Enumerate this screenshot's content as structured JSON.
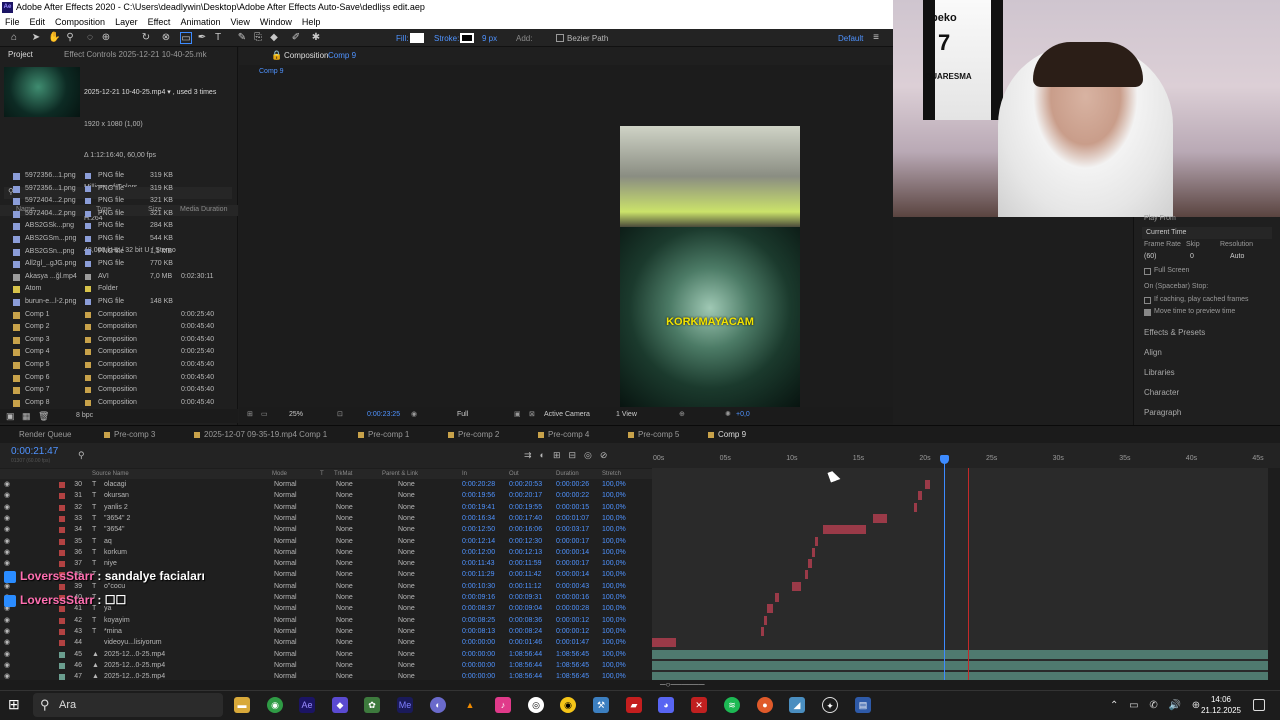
{
  "window": {
    "title": "Adobe After Effects 2020 - C:\\Users\\deadlywin\\Desktop\\Adobe After Effects Auto-Save\\dedlişs edit.aep"
  },
  "menu": [
    "File",
    "Edit",
    "Composition",
    "Layer",
    "Effect",
    "Animation",
    "View",
    "Window",
    "Help"
  ],
  "toolbar": {
    "fill_label": "Fill:",
    "stroke_label": "Stroke:",
    "stroke_px": "9 px",
    "add_label": "Add:",
    "bezier_label": "Bezier Path",
    "workspace": "Default"
  },
  "project": {
    "tab_project": "Project",
    "tab_effect": "Effect Controls 2025-12-21 10-40-25.mk",
    "file_name": "2025-12-21 10-40-25.mp4 ▾ , used 3 times",
    "info_lines": [
      "1920 x 1080 (1,00)",
      "Δ 1:12:16:40, 60,00 fps",
      "Millions of Colors",
      "H.264",
      "48,000 kHz / 32 bit U / Stereo"
    ],
    "search_placeholder": "⚲",
    "headers": {
      "name": "Name",
      "type": "Type",
      "size": "Size",
      "duration": "Media Duration"
    },
    "items": [
      {
        "name": "5972356...1.png",
        "type": "PNG file",
        "size": "319 KB",
        "dur": "",
        "color": "#8b9dd8"
      },
      {
        "name": "5972356...1.png",
        "type": "PNG file",
        "size": "319 KB",
        "dur": "",
        "color": "#8b9dd8"
      },
      {
        "name": "5972404...2.png",
        "type": "PNG file",
        "size": "321 KB",
        "dur": "",
        "color": "#8b9dd8"
      },
      {
        "name": "5972404...2.png",
        "type": "PNG file",
        "size": "321 KB",
        "dur": "",
        "color": "#8b9dd8"
      },
      {
        "name": "ABS2GSk...png",
        "type": "PNG file",
        "size": "284 KB",
        "dur": "",
        "color": "#8b9dd8"
      },
      {
        "name": "ABS2GSm...png",
        "type": "PNG file",
        "size": "544 KB",
        "dur": "",
        "color": "#8b9dd8"
      },
      {
        "name": "ABS2GSn...png",
        "type": "PNG file",
        "size": "1,1 MB",
        "dur": "",
        "color": "#8b9dd8"
      },
      {
        "name": "All2gl_..gJG.png",
        "type": "PNG file",
        "size": "770 KB",
        "dur": "",
        "color": "#8b9dd8"
      },
      {
        "name": "Akasya ...ğl.mp4",
        "type": "AVI",
        "size": "7,0 MB",
        "dur": "0:02:30:11",
        "color": "#9c9c9c"
      },
      {
        "name": "Atom",
        "type": "Folder",
        "size": "",
        "dur": "",
        "color": "#d6c24a"
      },
      {
        "name": "burun-e...l-2.png",
        "type": "PNG file",
        "size": "148 KB",
        "dur": "",
        "color": "#8b9dd8"
      },
      {
        "name": "Comp 1",
        "type": "Composition",
        "size": "",
        "dur": "0:00:25:40",
        "color": "#c8a24a"
      },
      {
        "name": "Comp 2",
        "type": "Composition",
        "size": "",
        "dur": "0:00:45:40",
        "color": "#c8a24a"
      },
      {
        "name": "Comp 3",
        "type": "Composition",
        "size": "",
        "dur": "0:00:45:40",
        "color": "#c8a24a"
      },
      {
        "name": "Comp 4",
        "type": "Composition",
        "size": "",
        "dur": "0:00:25:40",
        "color": "#c8a24a"
      },
      {
        "name": "Comp 5",
        "type": "Composition",
        "size": "",
        "dur": "0:00:45:40",
        "color": "#c8a24a"
      },
      {
        "name": "Comp 6",
        "type": "Composition",
        "size": "",
        "dur": "0:00:45:40",
        "color": "#c8a24a"
      },
      {
        "name": "Comp 7",
        "type": "Composition",
        "size": "",
        "dur": "0:00:45:40",
        "color": "#c8a24a"
      },
      {
        "name": "Comp 8",
        "type": "Composition",
        "size": "",
        "dur": "0:00:45:40",
        "color": "#c8a24a"
      }
    ],
    "footer_bpc": "8 bpc"
  },
  "composition": {
    "tab_label": "Composition",
    "tab_comp": "Comp 9",
    "subtab": "Comp 9",
    "overlay_text": "KORKMAYACAM",
    "zoom": "25%",
    "timecode": "0:00:23:25",
    "resolution": "Full",
    "camera": "Active Camera",
    "view": "1 View",
    "exposure": "+0,0"
  },
  "webcam": {
    "jersey_brand": "beko",
    "jersey_number": "7",
    "jersey_name": "QUARESMA"
  },
  "preview": {
    "title": "Play From",
    "current_time": "Current Time",
    "frame_rate_label": "Frame Rate",
    "skip_label": "Skip",
    "resolution_label": "Resolution",
    "frame_rate": "(60)",
    "skip": "0",
    "resolution": "Auto",
    "full_screen": "Full Screen",
    "on_stop": "On (Spacebar) Stop:",
    "cache_opt": "If caching, play cached frames",
    "move_opt": "Move time to preview time",
    "panels": [
      "Effects & Presets",
      "Align",
      "Libraries",
      "Character",
      "Paragraph"
    ]
  },
  "timeline": {
    "tabs": [
      {
        "label": "Render Queue",
        "color": ""
      },
      {
        "label": "Pre-comp 3",
        "color": "#c8a24a"
      },
      {
        "label": "2025-12-07 09-35-19.mp4 Comp 1",
        "color": "#c8a24a"
      },
      {
        "label": "Pre-comp 1",
        "color": "#c8a24a"
      },
      {
        "label": "Pre-comp 2",
        "color": "#c8a24a"
      },
      {
        "label": "Pre-comp 4",
        "color": "#c8a24a"
      },
      {
        "label": "Pre-comp 5",
        "color": "#c8a24a"
      },
      {
        "label": "Comp 9",
        "color": "#c8a24a"
      }
    ],
    "timecode": "0:00:21:47",
    "timecode_sub": "01307 (60.00 fps)",
    "headers": {
      "source": "Source Name",
      "mode": "Mode",
      "t": "T",
      "trkmat": "TrkMat",
      "parent": "Parent & Link",
      "in": "In",
      "out": "Out",
      "duration": "Duration",
      "stretch": "Stretch"
    },
    "ruler": [
      "00s",
      "05s",
      "10s",
      "15s",
      "20s",
      "25s",
      "30s",
      "35s",
      "40s",
      "45s"
    ],
    "layers": [
      {
        "num": "30",
        "type": "T",
        "name": "olacagi",
        "mode": "Normal",
        "trk": "None",
        "parent": "None",
        "in": "0:00:20:28",
        "out": "0:00:20:53",
        "dur": "0:00:00:26",
        "str": "100,0%",
        "color": "#b24242"
      },
      {
        "num": "31",
        "type": "T",
        "name": "okursan",
        "mode": "Normal",
        "trk": "None",
        "parent": "None",
        "in": "0:00:19:56",
        "out": "0:00:20:17",
        "dur": "0:00:00:22",
        "str": "100,0%",
        "color": "#b24242"
      },
      {
        "num": "32",
        "type": "T",
        "name": "yanlis 2",
        "mode": "Normal",
        "trk": "None",
        "parent": "None",
        "in": "0:00:19:41",
        "out": "0:00:19:55",
        "dur": "0:00:00:15",
        "str": "100,0%",
        "color": "#b24242"
      },
      {
        "num": "33",
        "type": "T",
        "name": "\"3654\" 2",
        "mode": "Normal",
        "trk": "None",
        "parent": "None",
        "in": "0:00:16:34",
        "out": "0:00:17:40",
        "dur": "0:00:01:07",
        "str": "100,0%",
        "color": "#b24242"
      },
      {
        "num": "34",
        "type": "T",
        "name": "\"3654\"",
        "mode": "Normal",
        "trk": "None",
        "parent": "None",
        "in": "0:00:12:50",
        "out": "0:00:16:06",
        "dur": "0:00:03:17",
        "str": "100,0%",
        "color": "#b24242"
      },
      {
        "num": "35",
        "type": "T",
        "name": "aq",
        "mode": "Normal",
        "trk": "None",
        "parent": "None",
        "in": "0:00:12:14",
        "out": "0:00:12:30",
        "dur": "0:00:00:17",
        "str": "100,0%",
        "color": "#b24242"
      },
      {
        "num": "36",
        "type": "T",
        "name": "korkum",
        "mode": "Normal",
        "trk": "None",
        "parent": "None",
        "in": "0:00:12:00",
        "out": "0:00:12:13",
        "dur": "0:00:00:14",
        "str": "100,0%",
        "color": "#b24242"
      },
      {
        "num": "37",
        "type": "T",
        "name": "niye",
        "mode": "Normal",
        "trk": "None",
        "parent": "None",
        "in": "0:00:11:43",
        "out": "0:00:11:59",
        "dur": "0:00:00:17",
        "str": "100,0%",
        "color": "#b24242"
      },
      {
        "num": "38",
        "type": "T",
        "name": "",
        "mode": "Normal",
        "trk": "None",
        "parent": "None",
        "in": "0:00:11:29",
        "out": "0:00:11:42",
        "dur": "0:00:00:14",
        "str": "100,0%",
        "color": "#b24242"
      },
      {
        "num": "39",
        "type": "T",
        "name": "o\"cocu",
        "mode": "Normal",
        "trk": "None",
        "parent": "None",
        "in": "0:00:10:30",
        "out": "0:00:11:12",
        "dur": "0:00:00:43",
        "str": "100,0%",
        "color": "#b24242"
      },
      {
        "num": "40",
        "type": "T",
        "name": "",
        "mode": "Normal",
        "trk": "None",
        "parent": "None",
        "in": "0:00:09:16",
        "out": "0:00:09:31",
        "dur": "0:00:00:16",
        "str": "100,0%",
        "color": "#b24242"
      },
      {
        "num": "41",
        "type": "T",
        "name": "ya",
        "mode": "Normal",
        "trk": "None",
        "parent": "None",
        "in": "0:00:08:37",
        "out": "0:00:09:04",
        "dur": "0:00:00:28",
        "str": "100,0%",
        "color": "#b24242"
      },
      {
        "num": "42",
        "type": "T",
        "name": "koyayim",
        "mode": "Normal",
        "trk": "None",
        "parent": "None",
        "in": "0:00:08:25",
        "out": "0:00:08:36",
        "dur": "0:00:00:12",
        "str": "100,0%",
        "color": "#b24242"
      },
      {
        "num": "43",
        "type": "T",
        "name": "*mina",
        "mode": "Normal",
        "trk": "None",
        "parent": "None",
        "in": "0:00:08:13",
        "out": "0:00:08:24",
        "dur": "0:00:00:12",
        "str": "100,0%",
        "color": "#b24242"
      },
      {
        "num": "44",
        "type": "",
        "name": "videoyu...lisiyorum",
        "mode": "Normal",
        "trk": "None",
        "parent": "None",
        "in": "0:00:00:00",
        "out": "0:00:01:46",
        "dur": "0:00:01:47",
        "str": "100,0%",
        "color": "#b24242"
      },
      {
        "num": "45",
        "type": "▲",
        "name": "2025-12...0-25.mp4",
        "mode": "Normal",
        "trk": "None",
        "parent": "None",
        "in": "0:00:00:00",
        "out": "1:08:56:44",
        "dur": "1:08:56:45",
        "str": "100,0%",
        "color": "#6a9e8f"
      },
      {
        "num": "46",
        "type": "▲",
        "name": "2025-12...0-25.mp4",
        "mode": "Normal",
        "trk": "None",
        "parent": "None",
        "in": "0:00:00:00",
        "out": "1:08:56:44",
        "dur": "1:08:56:45",
        "str": "100,0%",
        "color": "#6a9e8f"
      },
      {
        "num": "47",
        "type": "▲",
        "name": "2025-12...0-25.mp4",
        "mode": "Normal",
        "trk": "None",
        "parent": "None",
        "in": "0:00:00:00",
        "out": "1:08:56:44",
        "dur": "1:08:56:45",
        "str": "100,0%",
        "color": "#6a9e8f"
      }
    ]
  },
  "chat": [
    {
      "user": "LoverssStarr",
      "message": " : sandalye faciaları"
    },
    {
      "user": "LoverssStarr",
      "message": " : ☐☐"
    }
  ],
  "taskbar": {
    "search_placeholder": "Ara",
    "time": "14:06",
    "date": "21.12.2025"
  }
}
